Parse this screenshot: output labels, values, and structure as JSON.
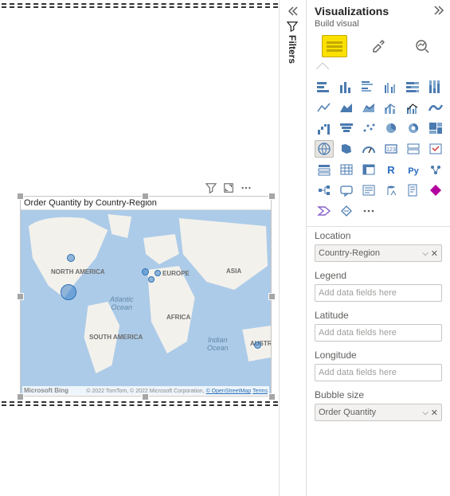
{
  "canvas": {
    "visual_title": "Order Quantity by Country-Region",
    "continents": {
      "north_america": "NORTH AMERICA",
      "south_america": "SOUTH AMERICA",
      "europe": "EUROPE",
      "africa": "AFRICA",
      "asia": "ASIA",
      "australia": "AUSTR"
    },
    "oceans": {
      "atlantic": "Atlantic\nOcean",
      "indian": "Indian\nOcean"
    },
    "credits": {
      "bing": "Microsoft Bing",
      "text": "© 2022 TomTom, © 2022 Microsoft Corporation,",
      "osm": "© OpenStreetMap",
      "terms": "Terms"
    }
  },
  "filters": {
    "label": "Filters"
  },
  "viz": {
    "title": "Visualizations",
    "build_label": "Build visual",
    "wells": {
      "location": {
        "label": "Location",
        "value": "Country-Region"
      },
      "legend": {
        "label": "Legend",
        "placeholder": "Add data fields here"
      },
      "latitude": {
        "label": "Latitude",
        "placeholder": "Add data fields here"
      },
      "longitude": {
        "label": "Longitude",
        "placeholder": "Add data fields here"
      },
      "bubble": {
        "label": "Bubble size",
        "value": "Order Quantity"
      }
    }
  }
}
